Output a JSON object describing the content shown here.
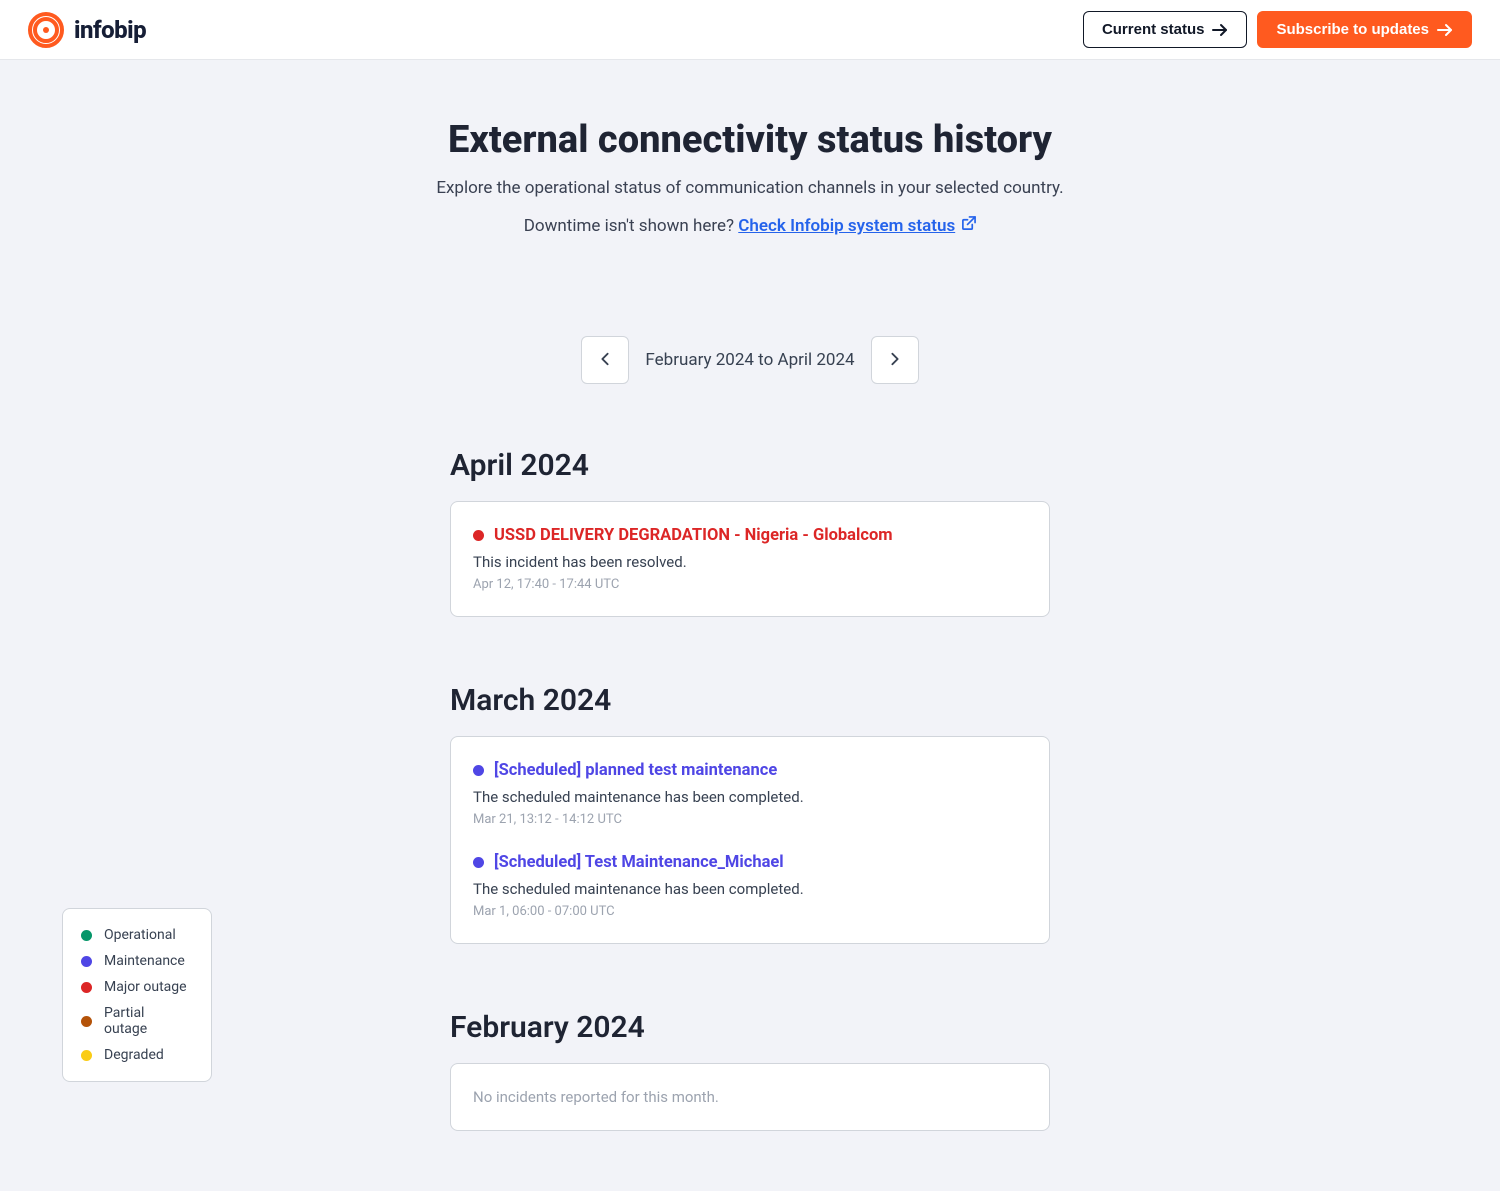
{
  "header": {
    "brand": "infobip",
    "current_status_label": "Current status",
    "subscribe_label": "Subscribe to updates"
  },
  "hero": {
    "title": "External connectivity status history",
    "subtitle": "Explore the operational status of communication channels in your selected country.",
    "downtime_prefix": "Downtime isn't shown here? ",
    "link_text": "Check Infobip system status"
  },
  "pager": {
    "range_label": "February 2024 to April 2024"
  },
  "months": [
    {
      "heading": "April 2024",
      "empty": null,
      "incidents": [
        {
          "status": "major",
          "color": "#dc2626",
          "title": "USSD DELIVERY DEGRADATION - Nigeria - Globalcom",
          "desc": "This incident has been resolved.",
          "time": "Apr 12, 17:40 - 17:44 UTC"
        }
      ]
    },
    {
      "heading": "March 2024",
      "empty": null,
      "incidents": [
        {
          "status": "maintenance",
          "color": "#4f46e5",
          "title": "[Scheduled] planned test maintenance",
          "desc": "The scheduled maintenance has been completed.",
          "time": "Mar 21, 13:12 - 14:12 UTC"
        },
        {
          "status": "maintenance",
          "color": "#4f46e5",
          "title": "[Scheduled] Test Maintenance_Michael",
          "desc": "The scheduled maintenance has been completed.",
          "time": "Mar 1, 06:00 - 07:00 UTC"
        }
      ]
    },
    {
      "heading": "February 2024",
      "empty": "No incidents reported for this month.",
      "incidents": []
    }
  ],
  "legend": {
    "items": [
      {
        "label": "Operational",
        "color": "#059669"
      },
      {
        "label": "Maintenance",
        "color": "#4f46e5"
      },
      {
        "label": "Major outage",
        "color": "#dc2626"
      },
      {
        "label": "Partial outage",
        "color": "#b45309"
      },
      {
        "label": "Degraded",
        "color": "#facc15"
      }
    ]
  }
}
